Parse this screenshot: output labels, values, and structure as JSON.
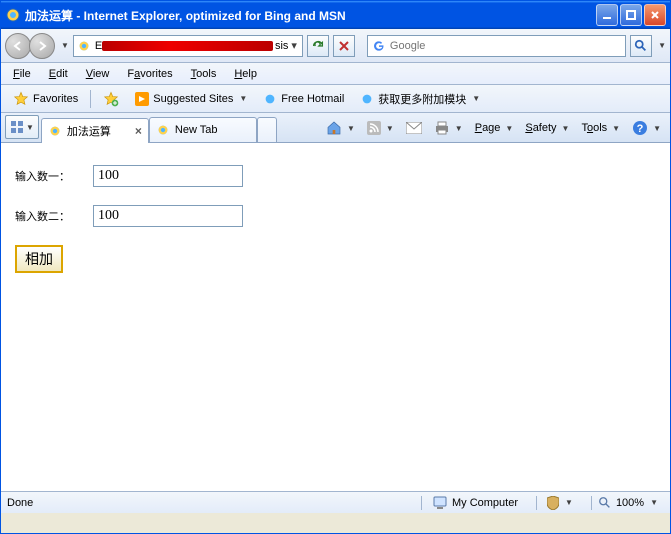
{
  "window": {
    "title": "加法运算 - Internet Explorer, optimized for Bing and MSN"
  },
  "address": {
    "url_end": "sis",
    "search_placeholder": "Google"
  },
  "menu": {
    "file": "File",
    "file_u": "F",
    "edit": "Edit",
    "edit_u": "E",
    "view": "View",
    "view_u": "V",
    "favorites": "Favorites",
    "favorites_u": "a",
    "tools": "Tools",
    "tools_u": "T",
    "help": "Help",
    "help_u": "H"
  },
  "favbar": {
    "favorites": "Favorites",
    "suggested": "Suggested Sites",
    "hotmail": "Free Hotmail",
    "addons": "获取更多附加模块"
  },
  "tabs": {
    "active": "加法运算",
    "new": "New Tab"
  },
  "commands": {
    "page": "Page",
    "page_u": "P",
    "safety": "Safety",
    "safety_u": "S",
    "tools": "Tools",
    "tools_u": "o"
  },
  "form": {
    "label1": "输入数一：",
    "value1": "100",
    "label2": "输入数二：",
    "value2": "100",
    "submit": "相加"
  },
  "status": {
    "done": "Done",
    "zone": "My Computer",
    "zoom": "100%"
  }
}
